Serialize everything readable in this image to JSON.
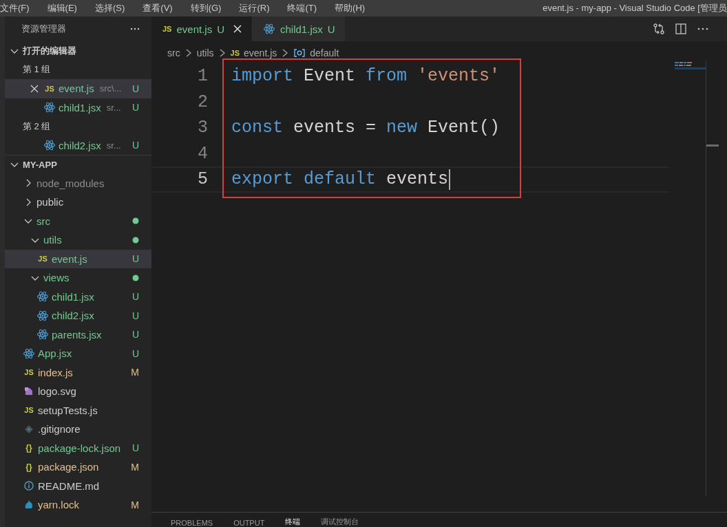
{
  "menu": [
    "文件(F)",
    "编辑(E)",
    "选择(S)",
    "查看(V)",
    "转到(G)",
    "运行(R)",
    "终端(T)",
    "帮助(H)"
  ],
  "window_title": "event.js - my-app - Visual Studio Code [管理员",
  "explorer": {
    "title": "资源管理器",
    "open_editors": {
      "label": "打开的编辑器",
      "expanded": true,
      "groups": [
        {
          "label": "第 1 组",
          "files": [
            {
              "kind": "js",
              "name": "event.js",
              "description": "src\\...",
              "badge": "U",
              "color": "#73c991",
              "icon_text": "JS",
              "selected": true,
              "close_shown": true
            },
            {
              "kind": "react",
              "name": "child1.jsx",
              "description": "sr...",
              "badge": "U",
              "color": "#73c991",
              "selected": false,
              "close_shown": false
            }
          ]
        },
        {
          "label": "第 2 组",
          "files": [
            {
              "kind": "react",
              "name": "child2.jsx",
              "description": "sr...",
              "badge": "U",
              "color": "#73c991",
              "selected": false,
              "close_shown": false
            }
          ]
        }
      ]
    },
    "project": {
      "label": "MY-APP",
      "expanded": true,
      "children": [
        {
          "kind": "folder",
          "name": "node_modules",
          "expanded": false,
          "color": "#8c8c8c",
          "has_changes": false,
          "selected": false
        },
        {
          "kind": "folder",
          "name": "public",
          "expanded": false,
          "has_changes": false,
          "selected": false
        },
        {
          "kind": "folder",
          "name": "src",
          "expanded": true,
          "color": "#73c991",
          "has_changes": true,
          "selected": false,
          "children": [
            {
              "kind": "folder",
              "name": "utils",
              "expanded": true,
              "color": "#73c991",
              "has_changes": true,
              "selected": false,
              "children": [
                {
                  "kind": "js",
                  "name": "event.js",
                  "icon_text": "JS",
                  "badge": "U",
                  "color": "#73c991",
                  "selected": true
                }
              ]
            },
            {
              "kind": "folder",
              "name": "views",
              "expanded": true,
              "color": "#73c991",
              "has_changes": true,
              "selected": false,
              "children": [
                {
                  "kind": "react",
                  "name": "child1.jsx",
                  "badge": "U",
                  "color": "#73c991",
                  "selected": false
                },
                {
                  "kind": "react",
                  "name": "child2.jsx",
                  "badge": "U",
                  "color": "#73c991",
                  "selected": false
                },
                {
                  "kind": "react",
                  "name": "parents.jsx",
                  "badge": "U",
                  "color": "#73c991",
                  "selected": false
                }
              ]
            }
          ]
        },
        {
          "kind": "react",
          "name": "App.jsx",
          "badge": "U",
          "color": "#73c991",
          "selected": false
        },
        {
          "kind": "js",
          "name": "index.js",
          "icon_text": "JS",
          "badge": "M",
          "color": "#e2c08d",
          "selected": false
        },
        {
          "kind": "svg",
          "name": "logo.svg",
          "selected": false
        },
        {
          "kind": "js",
          "name": "setupTests.js",
          "icon_text": "JS",
          "selected": false
        },
        {
          "kind": "git",
          "name": ".gitignore",
          "selected": false
        },
        {
          "kind": "json",
          "name": "package-lock.json",
          "icon_text": "{}",
          "badge": "U",
          "color": "#73c991",
          "selected": false
        },
        {
          "kind": "json",
          "name": "package.json",
          "icon_text": "{}",
          "badge": "M",
          "color": "#e2c08d",
          "selected": false
        },
        {
          "kind": "info",
          "name": "README.md",
          "selected": false
        },
        {
          "kind": "yarn",
          "name": "yarn.lock",
          "badge": "M",
          "color": "#e2c08d",
          "selected": false
        }
      ]
    }
  },
  "editor": {
    "tabs": [
      {
        "kind": "js",
        "label": "event.js",
        "badge": "U",
        "color": "#73c991",
        "icon_text": "JS",
        "selected": true,
        "close_shown": true
      },
      {
        "kind": "react",
        "label": "child1.jsx",
        "badge": "U",
        "color": "#73c991",
        "selected": false,
        "close_shown": false
      }
    ],
    "breadcrumb": [
      {
        "kind": "folder",
        "label": "src"
      },
      {
        "kind": "folder",
        "label": "utils"
      },
      {
        "kind": "js",
        "label": "event.js",
        "icon_text": "JS"
      },
      {
        "kind": "symbol",
        "label": "default"
      }
    ],
    "lines": [
      {
        "number": "1",
        "current": false,
        "tokens": [
          {
            "text": "import",
            "kind": "keyword"
          },
          {
            "text": " Event ",
            "kind": "plain"
          },
          {
            "text": "from ",
            "kind": "keyword"
          },
          {
            "text": "'events'",
            "kind": "string"
          }
        ]
      },
      {
        "number": "2",
        "current": false
      },
      {
        "number": "3",
        "current": false,
        "tokens": [
          {
            "text": "const",
            "kind": "keyword"
          },
          {
            "text": " events = ",
            "kind": "plain"
          },
          {
            "text": "new",
            "kind": "keyword"
          },
          {
            "text": " Event()",
            "kind": "plain"
          }
        ]
      },
      {
        "number": "4",
        "current": false
      },
      {
        "number": "5",
        "current": true,
        "tokens": [
          {
            "text": "export ",
            "kind": "keyword"
          },
          {
            "text": "default",
            "kind": "keyword"
          },
          {
            "text": " events",
            "kind": "plain"
          }
        ]
      }
    ],
    "highlight_box": true
  },
  "panel": {
    "tabs": [
      {
        "label": "PROBLEMS",
        "selected": false
      },
      {
        "label": "OUTPUT",
        "selected": false
      },
      {
        "label": "终端",
        "selected": true
      },
      {
        "label": "调试控制台",
        "selected": false
      }
    ]
  }
}
